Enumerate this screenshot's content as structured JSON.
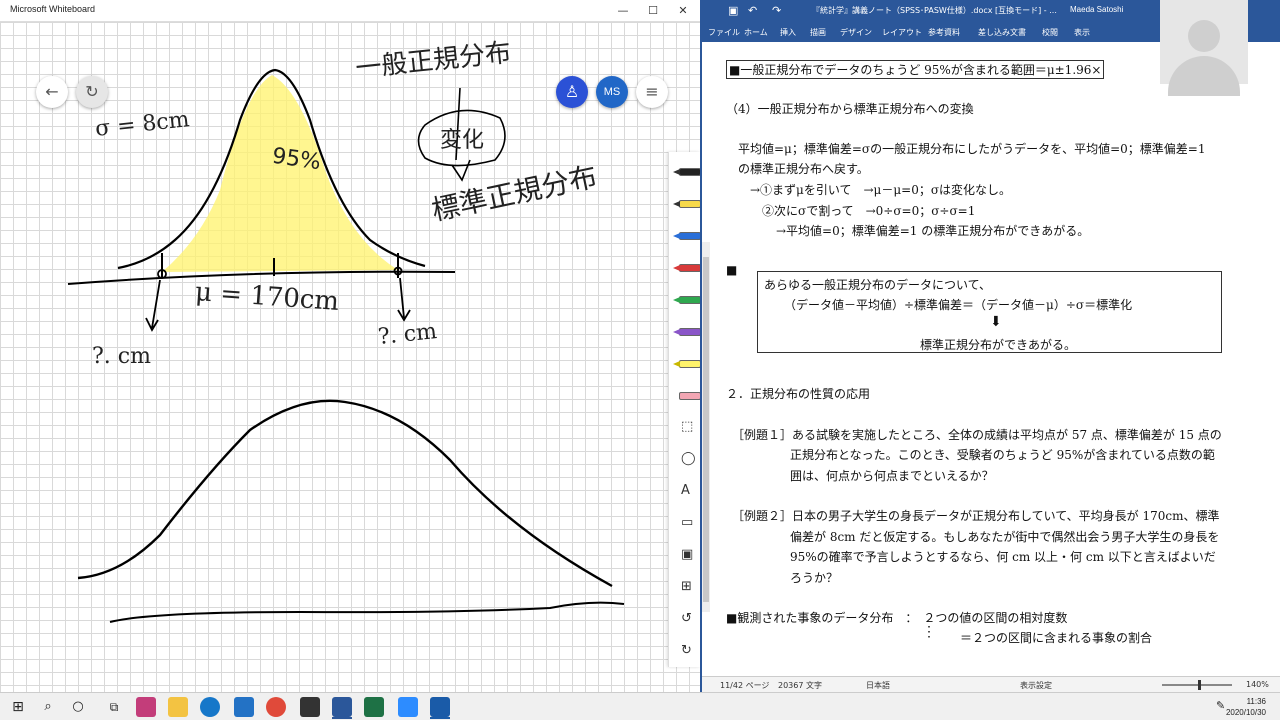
{
  "whiteboard": {
    "title": "Microsoft Whiteboard",
    "user_initials": "MS",
    "annotations": {
      "title": "一般正規分布",
      "bubble": "変化",
      "target": "標準正規分布",
      "percent": "95%",
      "sigma": "σ = 8cm",
      "mu": "μ = 170cm",
      "left_q": "?. cm",
      "right_q": "?. cm"
    }
  },
  "word": {
    "title": "『統計学』講義ノート（SPSS･PASW仕様）.docx [互換モード] - ...",
    "user": "Maeda Satoshi",
    "ribbon": [
      "ファイル",
      "ホーム",
      "挿入",
      "描画",
      "デザイン",
      "レイアウト",
      "参考資料",
      "差し込み文書",
      "校閲",
      "表示"
    ],
    "doc": {
      "l1": "■一般正規分布でデータのちょうど 95%が含まれる範囲＝μ±1.96×",
      "l2": "（4）一般正規分布から標準正規分布への変換",
      "l3": "平均値=μ；標準偏差=σの一般正規分布にしたがうデータを、平均値=0；標準偏差=1",
      "l4": "の標準正規分布へ戻す。",
      "l5": "→①まずμを引いて　→μ－μ=0；σは変化なし。",
      "l6": "②次にσで割って　→0÷σ=0；σ÷σ=1",
      "l7": "→平均値=0；標準偏差=1 の標準正規分布ができあがる。",
      "box1": "あらゆる一般正規分布のデータについて、",
      "box2": "（データ値－平均値）÷標準偏差＝（データ値－μ）÷σ＝標準化",
      "box3": "標準正規分布ができあがる。",
      "l8": "２．正規分布の性質の応用",
      "ex1a": "［例題１］ある試験を実施したところ、全体の成績は平均点が 57 点、標準偏差が 15 点の",
      "ex1b": "正規分布となった。このとき、受験者のちょうど 95%が含まれている点数の範",
      "ex1c": "囲は、何点から何点までといえるか？",
      "ex2a": "［例題２］日本の男子大学生の身長データが正規分布していて、平均身長が 170cm、標準",
      "ex2b": "偏差が 8cm だと仮定する。もしあなたが街中で偶然出会う男子大学生の身長を",
      "ex2c": "95%の確率で予言しようとするなら、何 cm 以上・何 cm 以下と言えばよいだ",
      "ex2d": "ろうか？",
      "l9": "■観測された事象のデータ分布　：　２つの値の区間の相対度数",
      "l10": "＝２つの区間に含まれる事象の割合"
    },
    "status": {
      "page": "11/42 ページ",
      "words": "20367 文字",
      "lang": "日本語",
      "display": "表示設定",
      "zoom": "140%"
    }
  },
  "taskbar": {
    "time": "11:36",
    "date": "2020/10/30"
  }
}
